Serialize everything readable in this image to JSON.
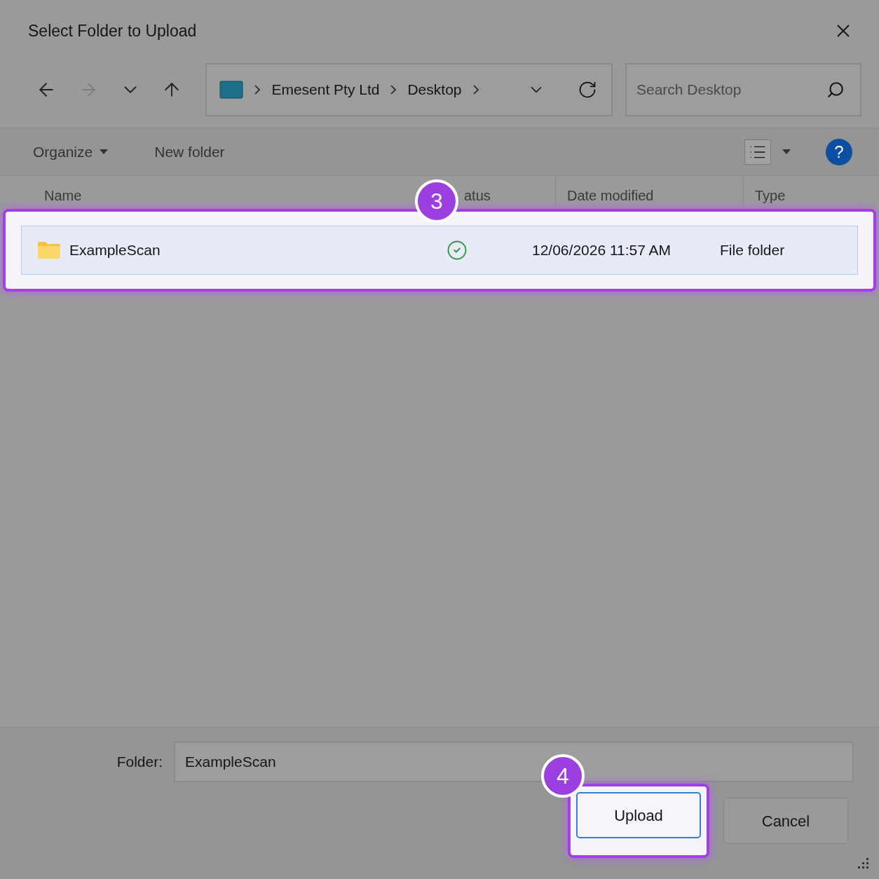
{
  "window": {
    "title": "Select Folder to Upload"
  },
  "nav": [
    {
      "kind": "back",
      "disabled": false
    },
    {
      "kind": "forward",
      "disabled": true
    },
    {
      "kind": "recent",
      "disabled": false
    },
    {
      "kind": "up",
      "disabled": false
    }
  ],
  "breadcrumbs": [
    "Emesent Pty Ltd",
    "Desktop"
  ],
  "search": {
    "placeholder": "Search Desktop"
  },
  "toolbar": {
    "organize": "Organize",
    "new_folder": "New folder",
    "help": "?"
  },
  "columns": [
    "Name",
    "atus",
    "Date modified",
    "Type"
  ],
  "rows": [
    {
      "name": "ExampleScan",
      "date": "12/06/2026 11:57 AM",
      "type": "File folder",
      "selected": true,
      "synced": true,
      "callout": "3"
    }
  ],
  "folder": {
    "label": "Folder:",
    "value": "ExampleScan"
  },
  "buttons": [
    {
      "label": "Upload",
      "kind": "primary",
      "callout": "4"
    },
    {
      "label": "Cancel",
      "kind": "secondary"
    }
  ]
}
